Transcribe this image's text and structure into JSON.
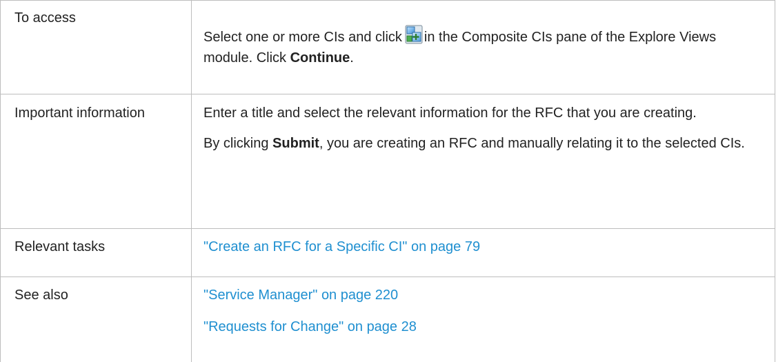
{
  "rows": [
    {
      "label": "To access",
      "text_before_icon": "Select one or more CIs and click",
      "icon": "add-composite-ci-icon",
      "text_after_icon": "in the Composite CIs pane of the Explore Views module. Click",
      "bold": "Continue",
      "text_end": "."
    },
    {
      "label": "Important information",
      "paragraph1": "Enter a title and select the relevant information for the RFC that you are creating.",
      "paragraph2_before": "By clicking",
      "paragraph2_bold": "Submit",
      "paragraph2_after": ", you are creating an RFC and manually relating it to the selected CIs."
    },
    {
      "label": "Relevant tasks",
      "links": [
        "\"Create an RFC for a Specific CI\" on page 79"
      ]
    },
    {
      "label": "See also",
      "links": [
        "\"Service Manager\" on page 220",
        "\"Requests for Change\" on page 28"
      ]
    }
  ],
  "colors": {
    "link": "#1f8fd0",
    "border": "#bdbdbd",
    "text": "#222222"
  }
}
